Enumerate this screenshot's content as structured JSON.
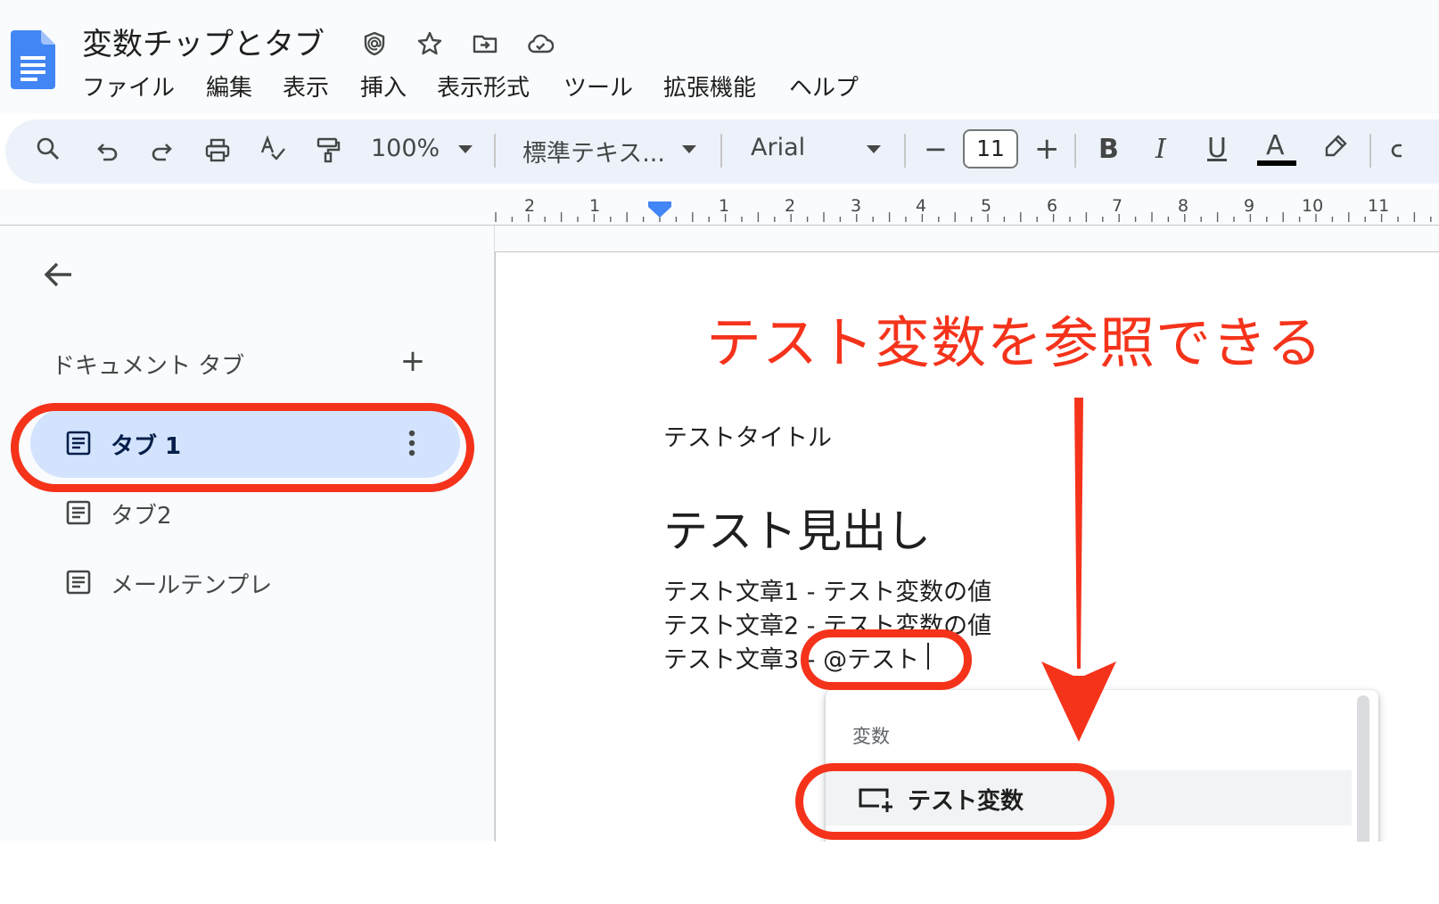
{
  "document": {
    "title": "変数チップとタブ",
    "menu": [
      "ファイル",
      "編集",
      "表示",
      "挿入",
      "表示形式",
      "ツール",
      "拡張機能",
      "ヘルプ"
    ]
  },
  "toolbar": {
    "zoom": "100%",
    "style": "標準テキス...",
    "font": "Arial",
    "font_size": "11",
    "minus": "−",
    "plus": "+",
    "bold": "B",
    "italic": "I",
    "underline": "U",
    "text_color_glyph": "A"
  },
  "ruler": {
    "labels": [
      "2",
      "1",
      "1",
      "2",
      "3",
      "4",
      "5",
      "6",
      "7",
      "8",
      "9",
      "10",
      "11"
    ]
  },
  "sidebar": {
    "heading": "ドキュメント タブ",
    "add": "+",
    "tabs": [
      {
        "label": "タブ 1",
        "selected": true
      },
      {
        "label": "タブ2",
        "selected": false
      },
      {
        "label": "メールテンプレ",
        "selected": false
      }
    ]
  },
  "page": {
    "title_text": "テストタイトル",
    "heading": "テスト見出し",
    "lines": [
      "テスト文章1 -  テスト変数の値",
      "テスト文章2 -  テスト変数の値",
      "テスト文章3 - @テスト"
    ]
  },
  "popup": {
    "section": "変数",
    "item": "テスト変数"
  },
  "annotation": {
    "text": "テスト変数を参照できる",
    "color": "#f5331b"
  },
  "colors": {
    "docs_blue": "#4285f4",
    "selected_tab_bg": "#d3e3fd",
    "toolbar_bg": "#edf2fa"
  }
}
